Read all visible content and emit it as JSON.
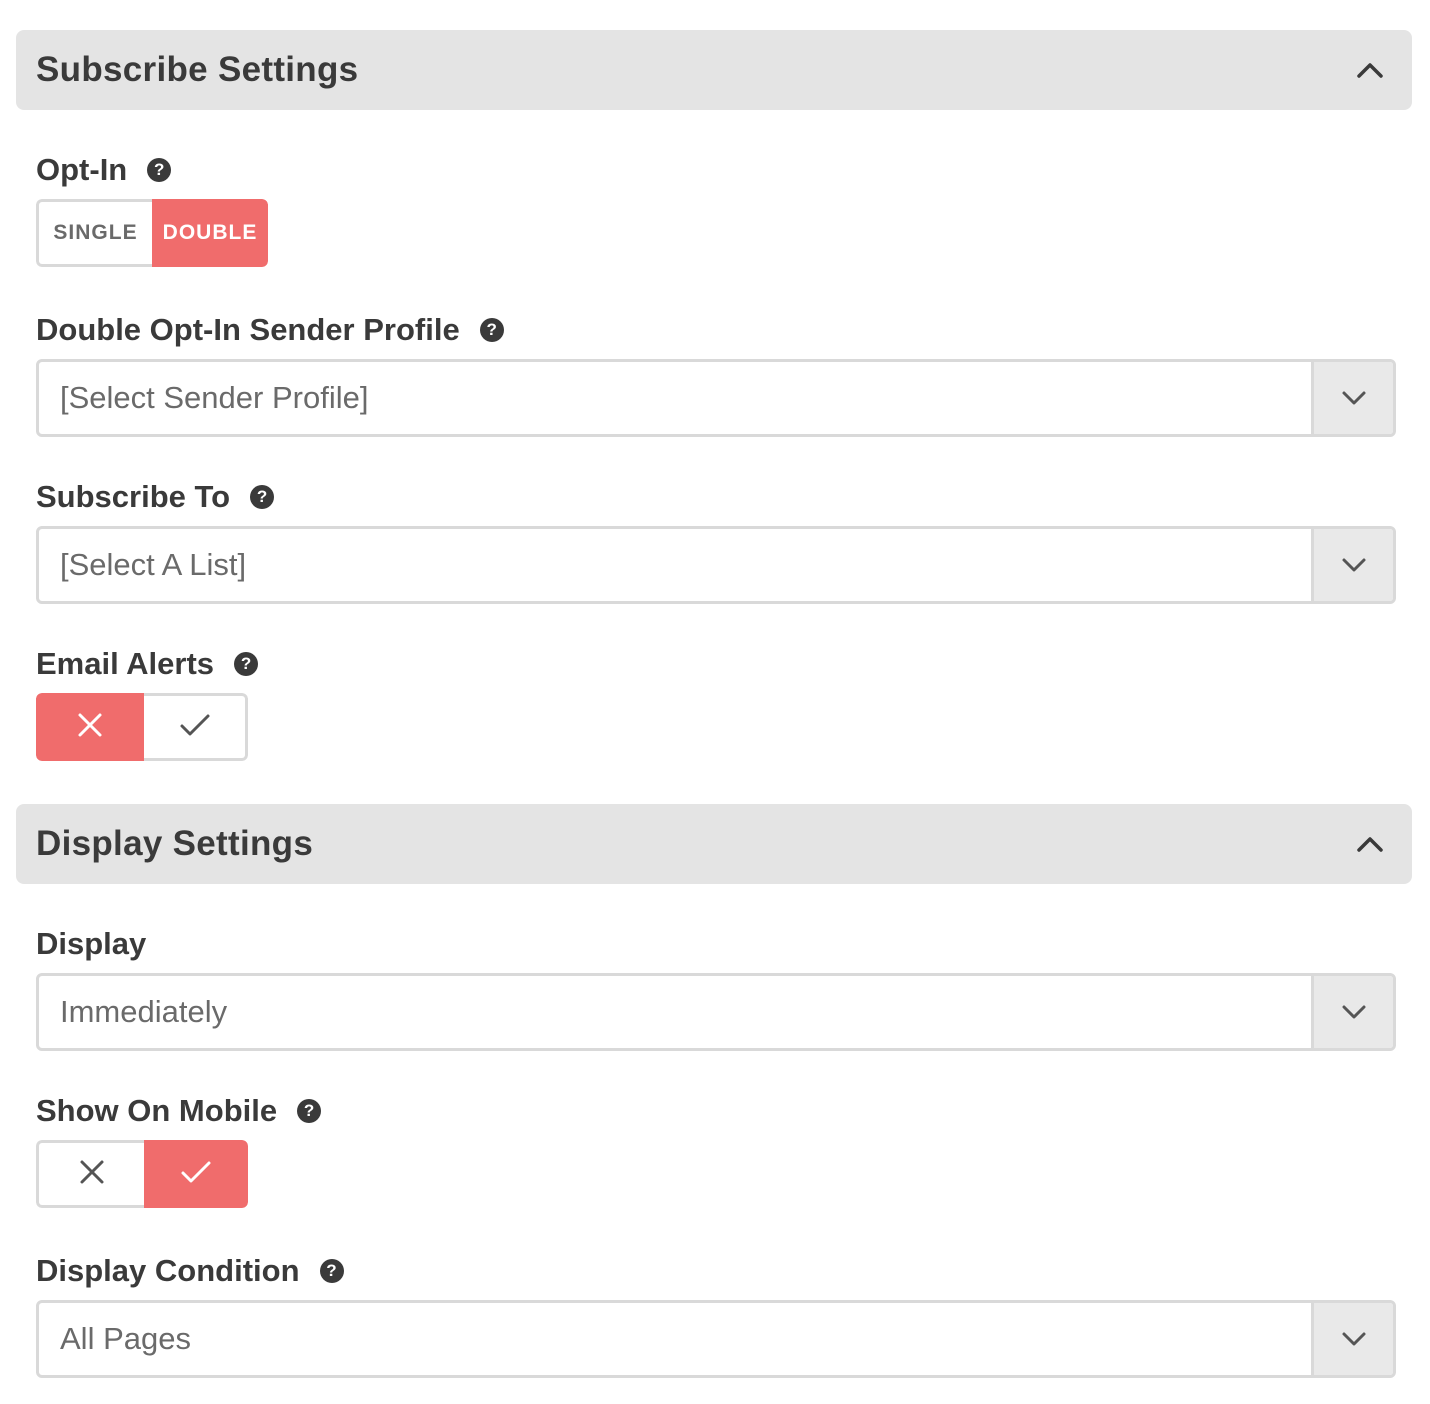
{
  "subscribe_section": {
    "title": "Subscribe Settings",
    "collapse_icon": "chevron-up-icon"
  },
  "opt_in": {
    "label": "Opt-In",
    "options": [
      "SINGLE",
      "DOUBLE"
    ],
    "selected": "DOUBLE"
  },
  "sender_profile": {
    "label": "Double Opt-In Sender Profile",
    "value": "[Select Sender Profile]"
  },
  "subscribe_to": {
    "label": "Subscribe To",
    "value": "[Select A List]"
  },
  "email_alerts": {
    "label": "Email Alerts",
    "value": "off"
  },
  "display_section": {
    "title": "Display Settings",
    "collapse_icon": "chevron-up-icon"
  },
  "display": {
    "label": "Display",
    "value": "Immediately"
  },
  "show_on_mobile": {
    "label": "Show On Mobile",
    "value": "on"
  },
  "display_condition": {
    "label": "Display Condition",
    "value": "All Pages"
  },
  "help_icon_glyph": "?",
  "colors": {
    "accent": "#f06c6c",
    "header_bg": "#e4e4e4",
    "text": "#3a3a3a",
    "border": "#d9d9d9"
  }
}
